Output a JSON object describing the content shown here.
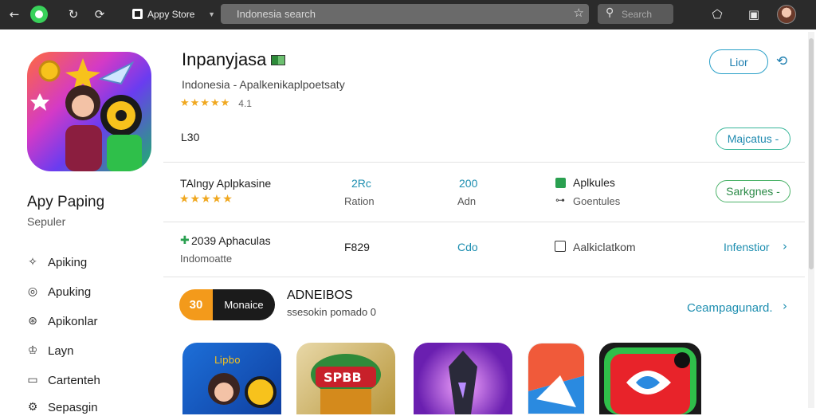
{
  "browser": {
    "tab_title": "Appy Store",
    "url_text": "Indonesia search",
    "search_placeholder": "Search"
  },
  "sidebar": {
    "app_name": "Apy Paping",
    "app_subtitle": "Sepuler",
    "nav": [
      {
        "label": "Apiking",
        "icon": "puzzle-icon"
      },
      {
        "label": "Apuking",
        "icon": "compass-icon"
      },
      {
        "label": "Apikonlar",
        "icon": "gamepad-icon"
      },
      {
        "label": "Layn",
        "icon": "crown-icon"
      },
      {
        "label": "Cartenteh",
        "icon": "cards-icon"
      },
      {
        "label": "Sepasgin",
        "icon": "gear-icon"
      }
    ]
  },
  "app": {
    "title": "Inpanyjasa",
    "subtitle": "Indonesia - Apalkenikaplpoetsaty",
    "stars": "★★★★★",
    "rating_value": "4.1",
    "size": "L30",
    "install_label": "Lior",
    "more_label": "Majcatus -",
    "settings_label": "Sarkgnes -"
  },
  "stats_row1": {
    "label": "TAlngy Aplpkasine",
    "stars": "★★★★★",
    "col1_value": "2Rc",
    "col1_label": "Ration",
    "col2_value": "200",
    "col2_label": "Adn",
    "col3_value": "Aplkules",
    "col3_label": "Goentules"
  },
  "stats_row2": {
    "label": "2039 Aphaculas",
    "sub": "Indomoatte",
    "col1_value": "F829",
    "col2_value": "Cdo",
    "col3_value": "Aalkiclatkom",
    "link_label": "Infenstior"
  },
  "promo": {
    "badge_left": "30",
    "badge_right": "Monaice",
    "title": "ADNEIBOS",
    "subtitle": "ssesokin pomado 0",
    "link_label": "Ceampagunard."
  },
  "colors": {
    "accent_blue": "#1f7fb0",
    "accent_green": "#2a8a46",
    "star": "#f0a820",
    "orange": "#f39a1b"
  }
}
